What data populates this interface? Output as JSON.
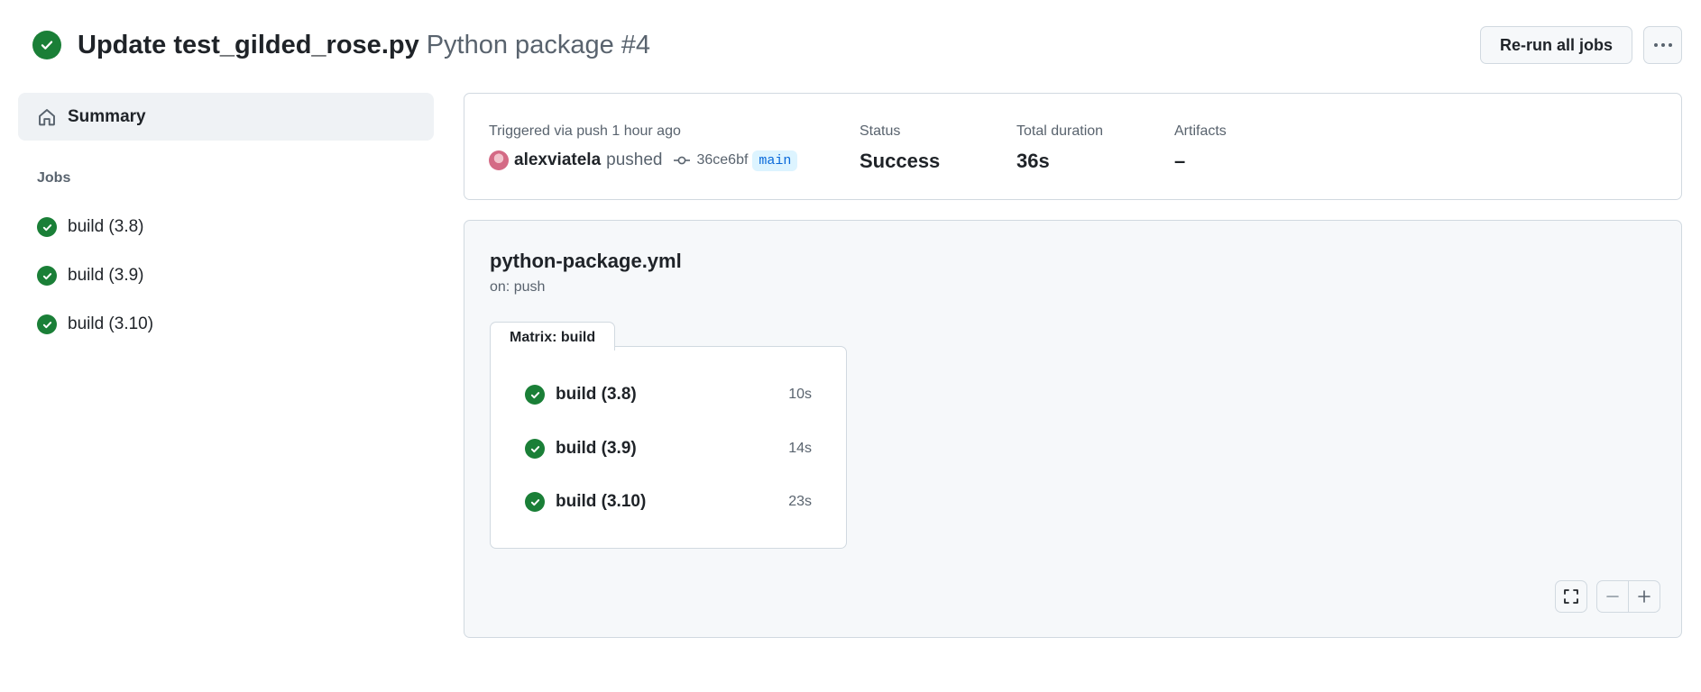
{
  "header": {
    "commit_title": "Update test_gilded_rose.py",
    "workflow_run": "Python package #4",
    "rerun_label": "Re-run all jobs",
    "more_label": "···",
    "status_icon": "check-circle-fill-icon"
  },
  "sidebar": {
    "summary_label": "Summary",
    "summary_icon": "home-icon",
    "jobs_heading": "Jobs",
    "jobs": [
      {
        "label": "build (3.8)"
      },
      {
        "label": "build (3.9)"
      },
      {
        "label": "build (3.10)"
      }
    ]
  },
  "run_info": {
    "trigger_label": "Triggered via push 1 hour ago",
    "user": "alexviatela",
    "action": "pushed",
    "commit_sha": "36ce6bf",
    "branch": "main",
    "status_label": "Status",
    "status_value": "Success",
    "duration_label": "Total duration",
    "duration_value": "36s",
    "artifacts_label": "Artifacts",
    "artifacts_value": "–"
  },
  "graph": {
    "workflow_file": "python-package.yml",
    "trigger": "on: push",
    "matrix_label": "Matrix: build",
    "jobs": [
      {
        "name": "build (3.8)",
        "duration": "10s"
      },
      {
        "name": "build (3.9)",
        "duration": "14s"
      },
      {
        "name": "build (3.10)",
        "duration": "23s"
      }
    ],
    "controls": [
      "fullscreen-icon",
      "zoom-out-icon",
      "zoom-in-icon"
    ]
  },
  "colors": {
    "success": "#1a7f37",
    "link": "#0969da",
    "muted": "#59636e",
    "border": "#d1d9e0",
    "panel_bg": "#f6f8fa"
  }
}
